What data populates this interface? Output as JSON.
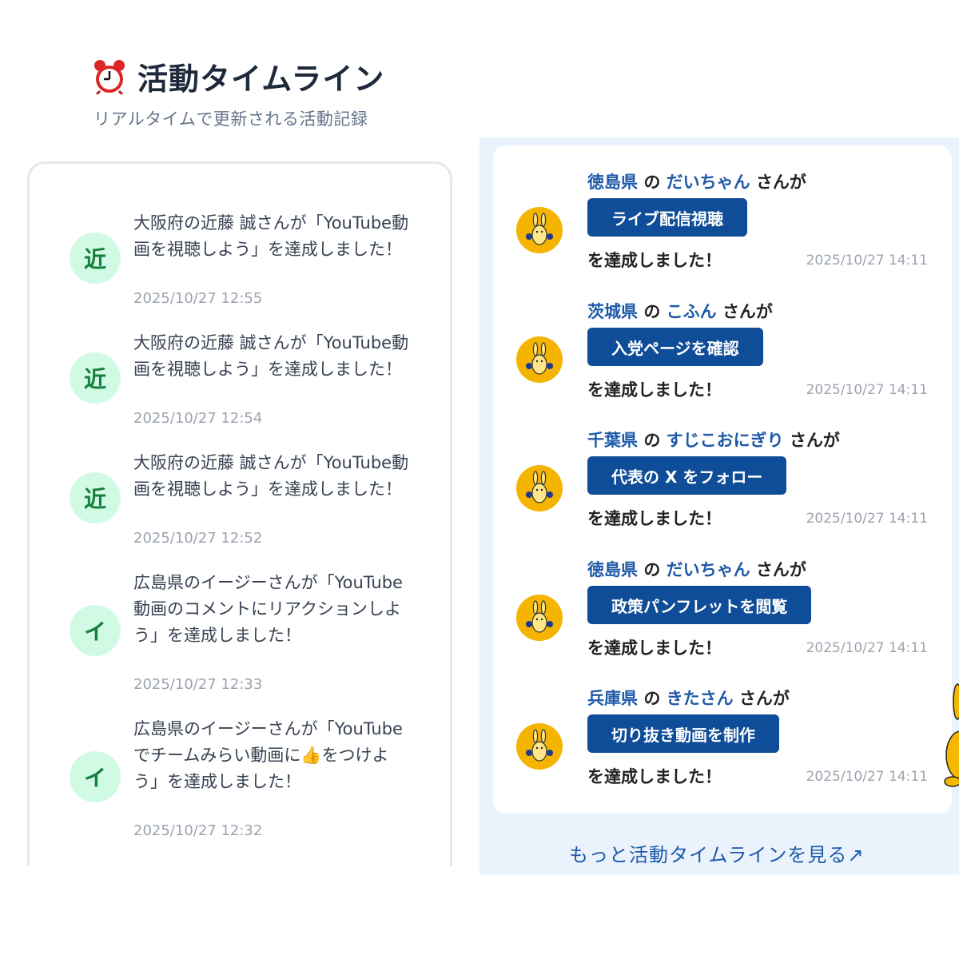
{
  "header": {
    "title": "活動タイムライン",
    "subtitle": "リアルタイムで更新される活動記録"
  },
  "left_feed": [
    {
      "avatar": "近",
      "text": "大阪府の近藤 誠さんが「YouTube動画を視聴しよう」を達成しました！",
      "time": "2025/10/27 12:55"
    },
    {
      "avatar": "近",
      "text": "大阪府の近藤 誠さんが「YouTube動画を視聴しよう」を達成しました！",
      "time": "2025/10/27 12:54"
    },
    {
      "avatar": "近",
      "text": "大阪府の近藤 誠さんが「YouTube動画を視聴しよう」を達成しました！",
      "time": "2025/10/27 12:52"
    },
    {
      "avatar": "イ",
      "text": "広島県のイージーさんが「YouTube動画のコメントにリアクションしよう」を達成しました！",
      "time": "2025/10/27 12:33"
    },
    {
      "avatar": "イ",
      "text": "広島県のイージーさんが「YouTubeでチームみらい動画に👍をつけよう」を達成しました！",
      "time": "2025/10/27 12:32"
    }
  ],
  "right_feed": {
    "connector_no": "の",
    "connector_ga": "さんが",
    "achieved": "を達成しました！",
    "items": [
      {
        "pref": "徳島県",
        "name": "だいちゃん",
        "mission": "ライブ配信視聴",
        "time": "2025/10/27 14:11",
        "avatar_icon": "mascot-rabbit-icon"
      },
      {
        "pref": "茨城県",
        "name": "こふん",
        "mission": "入党ページを確認",
        "time": "2025/10/27 14:11",
        "avatar_icon": "mascot-rabbit-icon"
      },
      {
        "pref": "千葉県",
        "name": "すじこおにぎり",
        "mission": "代表の X をフォロー",
        "time": "2025/10/27 14:11",
        "avatar_icon": "mascot-rabbit-icon"
      },
      {
        "pref": "徳島県",
        "name": "だいちゃん",
        "mission": "政策パンフレットを閲覧",
        "time": "2025/10/27 14:11",
        "avatar_icon": "mascot-rabbit-icon"
      },
      {
        "pref": "兵庫県",
        "name": "きたさん",
        "mission": "切り抜き動画を制作",
        "time": "2025/10/27 14:11",
        "avatar_icon": "mascot-rabbit-icon"
      }
    ]
  },
  "more_link": "もっと活動タイムラインを見る↗",
  "colors": {
    "accent_blue": "#0f4d99",
    "link_blue": "#1e5aa8",
    "avatar_green_bg": "#d1fae5",
    "panel_bg": "#eaf2fb"
  }
}
